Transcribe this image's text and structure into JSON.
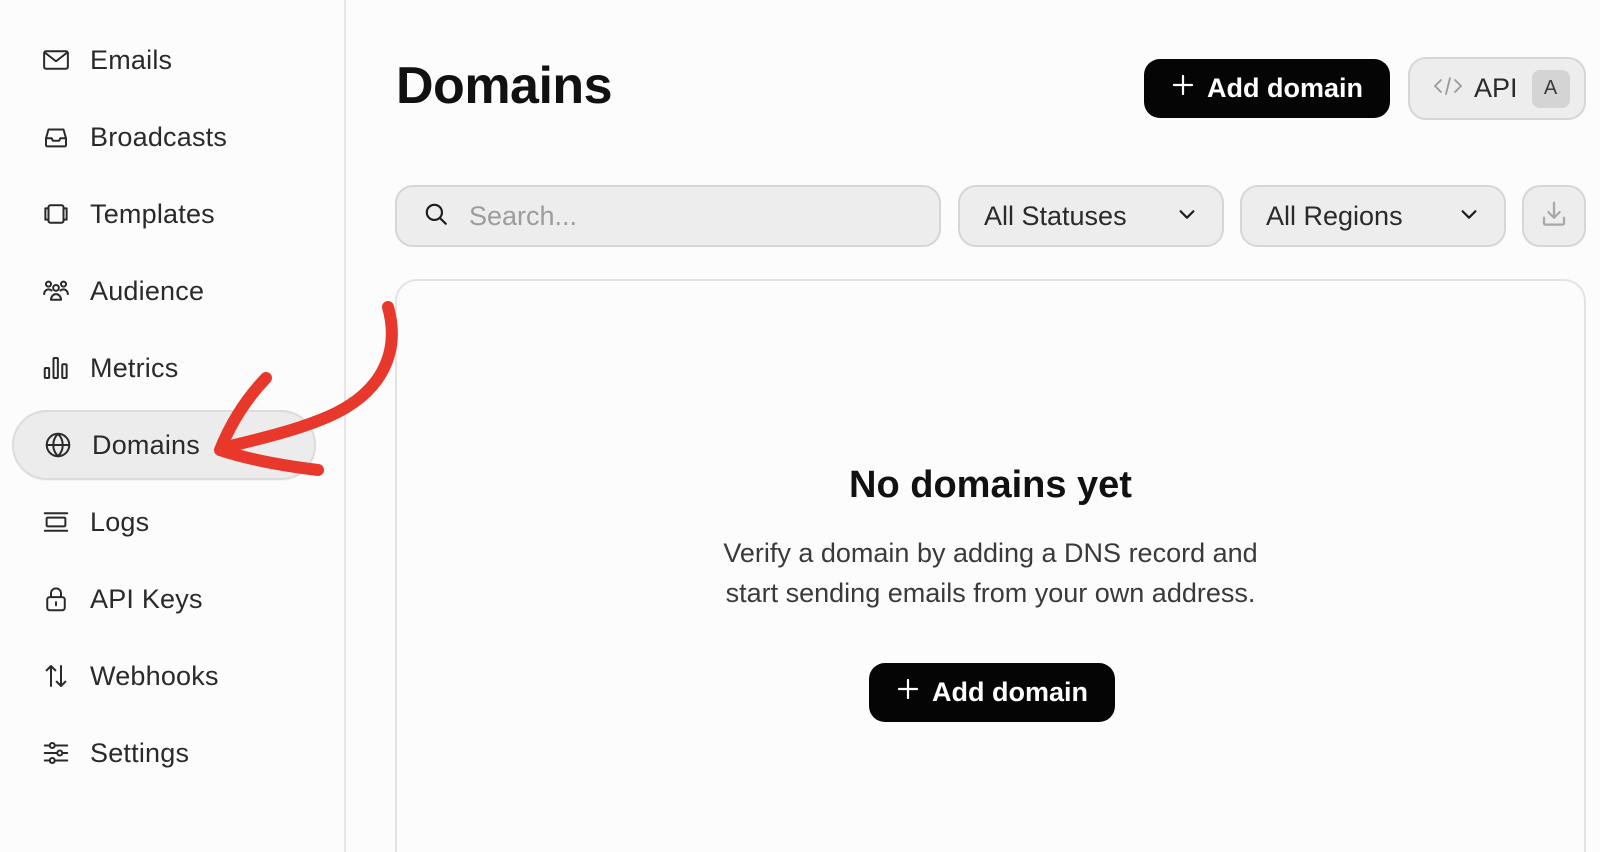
{
  "sidebar": {
    "items": [
      {
        "label": "Emails",
        "icon": "mail-icon"
      },
      {
        "label": "Broadcasts",
        "icon": "inbox-tray-icon"
      },
      {
        "label": "Templates",
        "icon": "templates-icon"
      },
      {
        "label": "Audience",
        "icon": "users-icon"
      },
      {
        "label": "Metrics",
        "icon": "bar-chart-icon"
      },
      {
        "label": "Domains",
        "icon": "globe-icon",
        "active": true
      },
      {
        "label": "Logs",
        "icon": "logs-icon"
      },
      {
        "label": "API Keys",
        "icon": "lock-icon"
      },
      {
        "label": "Webhooks",
        "icon": "arrows-up-down-icon"
      },
      {
        "label": "Settings",
        "icon": "sliders-icon"
      }
    ]
  },
  "header": {
    "title": "Domains",
    "add_button_label": "Add domain",
    "api_button_label": "API",
    "api_shortcut_key": "A"
  },
  "filters": {
    "search_placeholder": "Search...",
    "status_selected": "All Statuses",
    "region_selected": "All Regions"
  },
  "empty_state": {
    "title": "No domains yet",
    "description_line1": "Verify a domain by adding a DNS record and",
    "description_line2": "start sending emails from your own address.",
    "add_button_label": "Add domain"
  },
  "colors": {
    "primary_button": "#050505",
    "annotation_arrow": "#e8382b",
    "control_background": "#ededed"
  }
}
